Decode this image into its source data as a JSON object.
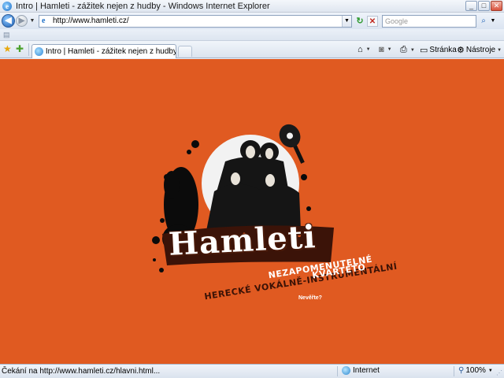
{
  "window": {
    "title": "Intro | Hamleti - zážitek nejen z hudby - Windows Internet Explorer",
    "buttons": {
      "minimize": "_",
      "maximize": "□",
      "close": "✕"
    }
  },
  "address_bar": {
    "url": "http://www.hamleti.cz/",
    "search_placeholder": "Google"
  },
  "tabs": [
    {
      "label": "Intro | Hamleti - zážitek nejen z hudby"
    }
  ],
  "command_bar": {
    "page_label": "Stránka",
    "tools_label": "Nástroje"
  },
  "page": {
    "background_color": "#e05a21",
    "band_name": "Hamleti",
    "tagline_line1": "NEZAPOMENUTELNÉ",
    "tagline_line2": "HERECKÉ VOKÁLNĚ-INSTRUMENTÁLNÍ",
    "tagline_line3": "KVARTETO",
    "enter_link": "Nevěřte?"
  },
  "status_bar": {
    "text": "Čekání na http://www.hamleti.cz/hlavni.html...",
    "zone": "Internet",
    "zoom": "100%"
  }
}
